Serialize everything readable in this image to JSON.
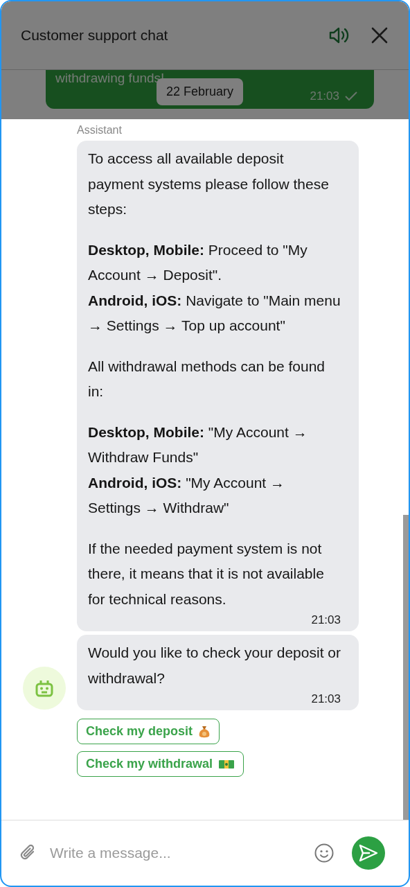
{
  "header": {
    "title": "Customer support chat"
  },
  "sent_message": {
    "text": "withdrawing funds!",
    "time": "21:03",
    "read": true
  },
  "date_chip": "22 February",
  "sender": "Assistant",
  "messages": [
    {
      "paragraphs": [
        [
          "To access all available deposit payment systems please follow these steps:"
        ],
        [
          "**Desktop, Mobile:** Proceed to \"My Account → Deposit\".",
          "**Android, iOS:** Navigate to \"Main menu → Settings → Top up account\""
        ],
        [
          "All withdrawal methods can be found in:"
        ],
        [
          "**Desktop, Mobile:** \"My Account → Withdraw Funds\"",
          "**Android, iOS:** \"My Account → Settings → Withdraw\""
        ],
        [
          "If the needed payment system is not there, it means that it is not available for technical reasons."
        ]
      ],
      "time": "21:03"
    },
    {
      "paragraphs": [
        [
          "Would you like to check your deposit or withdrawal?"
        ]
      ],
      "time": "21:03"
    }
  ],
  "quick_replies": [
    {
      "label": "Check my deposit"
    },
    {
      "label": "Check my withdrawal"
    }
  ],
  "composer": {
    "placeholder": "Write a message..."
  }
}
